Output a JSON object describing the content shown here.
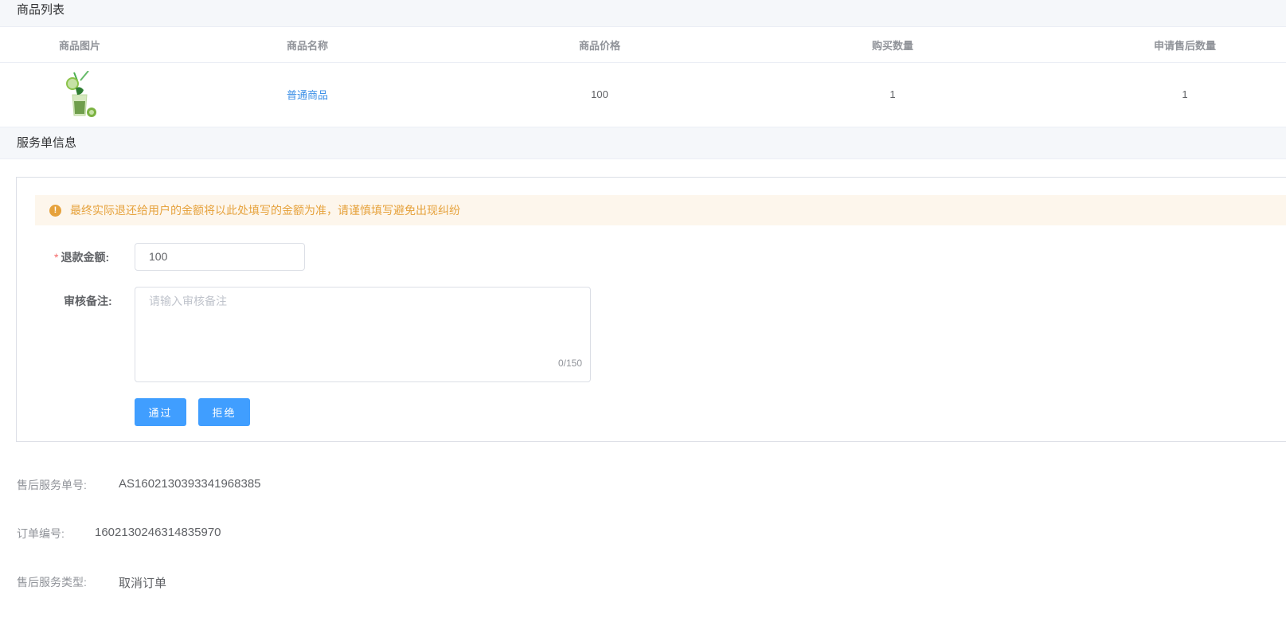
{
  "product_section": {
    "title": "商品列表",
    "columns": [
      "商品图片",
      "商品名称",
      "商品价格",
      "购买数量",
      "申请售后数量"
    ],
    "rows": [
      {
        "image": "drink-image",
        "name": "普通商品",
        "price": "100",
        "quantity": "1",
        "aftersale_quantity": "1"
      }
    ]
  },
  "service_section": {
    "title": "服务单信息",
    "alert": "最终实际退还给用户的金额将以此处填写的金额为准，请谨慎填写避免出现纠纷",
    "refund_label": "退款金额:",
    "refund_required_mark": "*",
    "refund_value": "100",
    "remark_label": "审核备注:",
    "remark_placeholder": "请输入审核备注",
    "remark_counter": "0/150",
    "approve_button": "通过",
    "reject_button": "拒绝"
  },
  "info": {
    "service_no_label": "售后服务单号:",
    "service_no": "AS1602130393341968385",
    "order_no_label": "订单编号:",
    "order_no": "1602130246314835970",
    "service_type_label": "售后服务类型:",
    "service_type": "取消订单"
  },
  "colors": {
    "primary": "#409eff",
    "warning": "#e6a23c",
    "link": "#3a8ee6"
  }
}
